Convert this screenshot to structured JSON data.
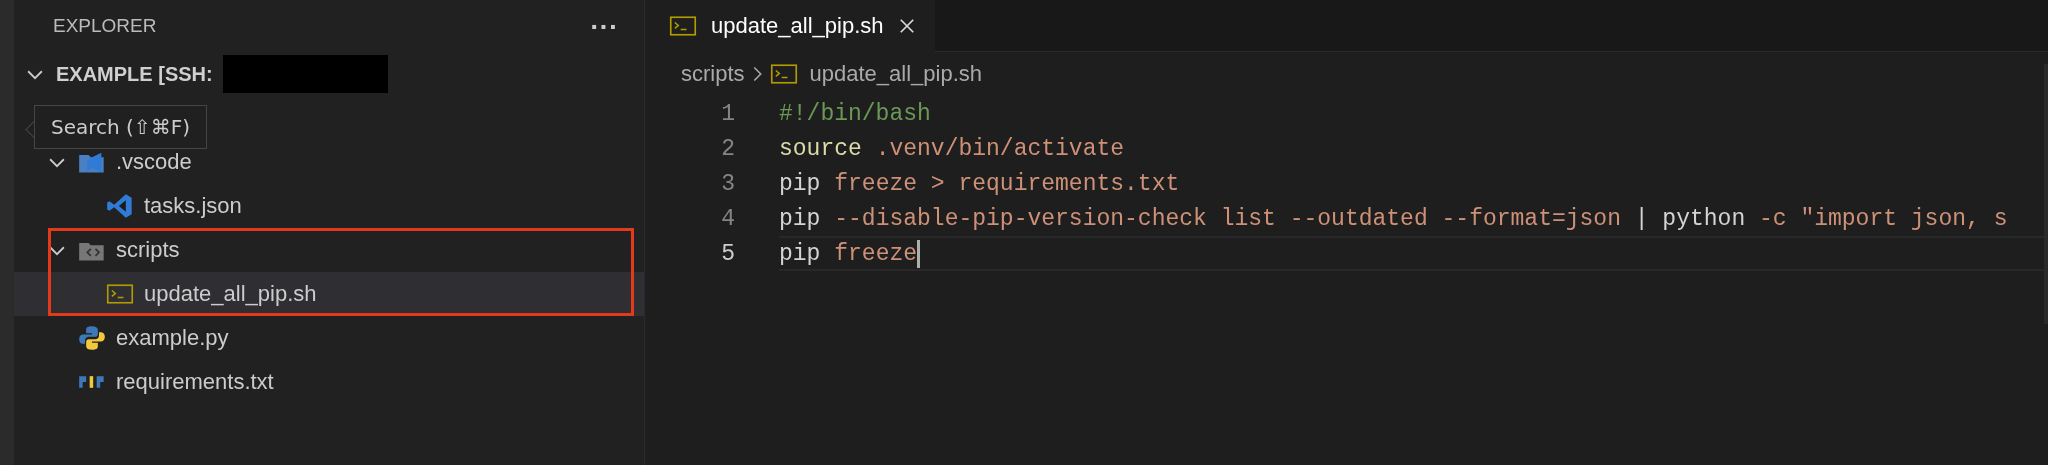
{
  "sidebar": {
    "title": "EXPLORER",
    "more_label": "···",
    "root": {
      "label": "EXAMPLE [SSH:",
      "expanded": true,
      "redacted": true
    },
    "tree": [
      {
        "label": ".vscode",
        "kind": "folder-vscode",
        "expanded": true,
        "selected": false,
        "children": [
          {
            "label": "tasks.json",
            "kind": "vscode",
            "selected": false
          }
        ]
      },
      {
        "label": "scripts",
        "kind": "folder-scripts",
        "expanded": true,
        "selected": false,
        "highlighted": true,
        "children": [
          {
            "label": "update_all_pip.sh",
            "kind": "shell",
            "selected": true,
            "highlighted": true
          }
        ]
      },
      {
        "label": "example.py",
        "kind": "python",
        "selected": false
      },
      {
        "label": "requirements.txt",
        "kind": "pip",
        "selected": false
      }
    ],
    "tooltip": "Search (⇧⌘F)"
  },
  "editor": {
    "tabs": [
      {
        "label": "update_all_pip.sh",
        "kind": "shell",
        "selected": true
      }
    ],
    "breadcrumb": [
      {
        "label": "scripts",
        "kind": "folder"
      },
      {
        "label": "update_all_pip.sh",
        "kind": "shell"
      }
    ],
    "lines": [
      {
        "number": "1",
        "active": false,
        "tokens": [
          {
            "text": "#!/bin/bash",
            "kind": "comment"
          }
        ]
      },
      {
        "number": "2",
        "active": false,
        "tokens": [
          {
            "text": "source",
            "kind": "keyword"
          },
          {
            "text": " .venv/bin/activate",
            "kind": "string"
          }
        ]
      },
      {
        "number": "3",
        "active": false,
        "tokens": [
          {
            "text": "pip",
            "kind": "plain"
          },
          {
            "text": " freeze > requirements.txt",
            "kind": "string"
          }
        ]
      },
      {
        "number": "4",
        "active": false,
        "tokens": [
          {
            "text": "pip",
            "kind": "plain"
          },
          {
            "text": " --disable-pip-version-check list --outdated --format=json ",
            "kind": "string"
          },
          {
            "text": "| python",
            "kind": "plain"
          },
          {
            "text": " -c \"import json, s",
            "kind": "string"
          }
        ]
      },
      {
        "number": "5",
        "active": true,
        "tokens": [
          {
            "text": "pip",
            "kind": "plain"
          },
          {
            "text": " freeze",
            "kind": "string"
          }
        ]
      }
    ]
  }
}
